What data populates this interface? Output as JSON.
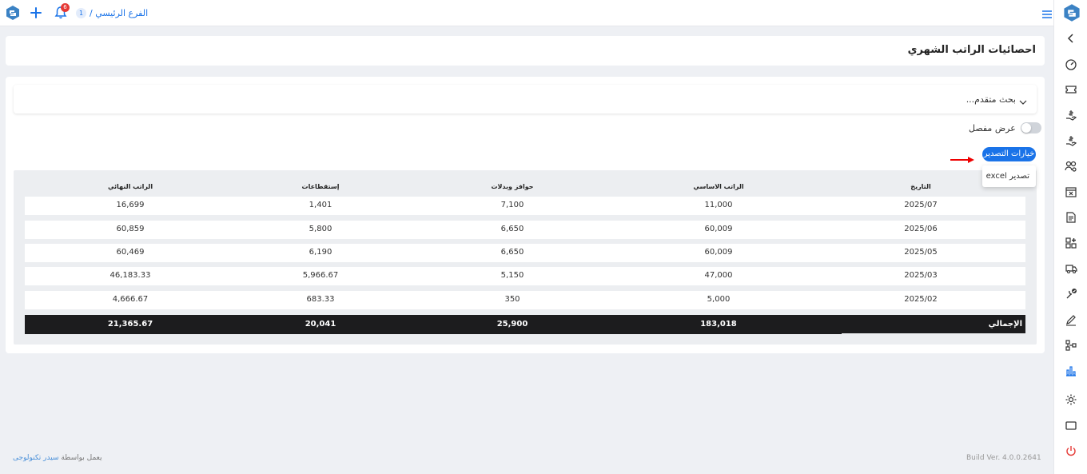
{
  "topbar": {
    "notification_count": "6",
    "branch_number": "1",
    "branch_name": "الفرع الرئيسي /"
  },
  "page": {
    "title": "احصائيات الراتب الشهري"
  },
  "filters": {
    "advanced_search_label": "بحث متقدم...",
    "detailed_view_label": "عرض مفصل",
    "detailed_view_on": false
  },
  "export": {
    "button_label": "خيارات التصدير",
    "menu_item": "تصدير excel"
  },
  "table": {
    "headers": {
      "date": "التاريخ",
      "basic_salary": "الراتب الاساسي",
      "allowances": "حوافز وبدلات",
      "deductions": "إستقطاعات",
      "final_salary": "الراتب النهائي"
    },
    "rows": [
      {
        "date": "2025/07",
        "basic_salary": "11,000",
        "allowances": "7,100",
        "deductions": "1,401",
        "final_salary": "16,699"
      },
      {
        "date": "2025/06",
        "basic_salary": "60,009",
        "allowances": "6,650",
        "deductions": "5,800",
        "final_salary": "60,859"
      },
      {
        "date": "2025/05",
        "basic_salary": "60,009",
        "allowances": "6,650",
        "deductions": "6,190",
        "final_salary": "60,469"
      },
      {
        "date": "2025/03",
        "basic_salary": "47,000",
        "allowances": "5,150",
        "deductions": "5,966.67",
        "final_salary": "46,183.33"
      },
      {
        "date": "2025/02",
        "basic_salary": "5,000",
        "allowances": "350",
        "deductions": "683.33",
        "final_salary": "4,666.67"
      }
    ],
    "total": {
      "label": "الإجمالي",
      "basic_salary": "183,018",
      "allowances": "25,900",
      "deductions": "20,041",
      "final_salary": "21,365.67"
    }
  },
  "footer": {
    "build": "Build Ver. 4.0.0.2641",
    "powered_by": "يعمل بواسطة",
    "brand": "سيدر تكنولوجى"
  },
  "sidebar": {
    "items": [
      "chevron-left-icon",
      "speedometer-icon",
      "ticket-icon",
      "hand-money-icon",
      "hand-coin-icon",
      "users-gear-icon",
      "calendar-x-icon",
      "document-icon",
      "grid-plus-icon",
      "truck-icon",
      "tool-check-icon",
      "pen-icon",
      "org-chart-icon",
      "bar-chart-icon",
      "gear-icon",
      "window-icon",
      "power-icon"
    ]
  },
  "colors": {
    "accent": "#1a73e8",
    "total_row": "#1c1c1e",
    "power": "#e53935"
  }
}
